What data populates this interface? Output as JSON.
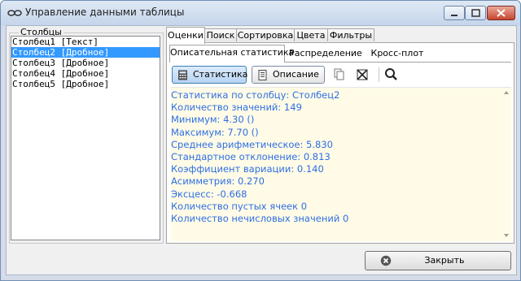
{
  "window": {
    "title": "Управление данными таблицы"
  },
  "columns_group": {
    "legend": "Столбцы",
    "items": [
      "Столбец1 [Текст]",
      "Столбец2 [Дробное]",
      "Столбец3 [Дробное]",
      "Столбец4 [Дробное]",
      "Столбец5 [Дробное]"
    ],
    "selected_index": 1
  },
  "tabs": [
    "Оценки",
    "Поиск",
    "Сортировка",
    "Цвета",
    "Фильтры"
  ],
  "active_tab": "Оценки",
  "subtabs": [
    "Описательная статистика",
    "Распределение",
    "Кросс-плот"
  ],
  "active_subtab": "Описательная статистика",
  "toolbar": {
    "stats_label": "Статистика",
    "desc_label": "Описание"
  },
  "stats_lines": [
    "Статистика по столбцу: Столбец2",
    "Количество значений: 149",
    "Минимум: 4.30 ()",
    "Максимум: 7.70 ()",
    "Среднее арифметическое: 5.830",
    "Стандартное отклонение: 0.813",
    "Коэффициент вариации: 0.140",
    "Асимметрия: 0.270",
    "Эксцесс: -0.668",
    "Количество пустых ячеек 0",
    "Количество нечисловых значений 0"
  ],
  "footer": {
    "close_label": "Закрыть"
  },
  "colors": {
    "stats_text": "#2e6ee6",
    "stats_bg": "#fffbe6",
    "selection": "#3399ff"
  }
}
